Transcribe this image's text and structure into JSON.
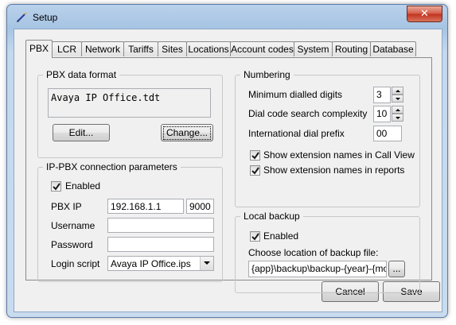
{
  "window": {
    "title": "Setup",
    "close_glyph": "✕",
    "icon": "pen-icon"
  },
  "tabs": [
    "PBX",
    "LCR",
    "Network",
    "Tariffs",
    "Sites",
    "Locations",
    "Account codes",
    "System",
    "Routing",
    "Database"
  ],
  "active_tab": "PBX",
  "pbx_data_format": {
    "legend": "PBX data format",
    "value": "Avaya IP Office.tdt",
    "edit_label": "Edit...",
    "change_label": "Change..."
  },
  "connection": {
    "legend": "IP-PBX connection parameters",
    "enabled_label": "Enabled",
    "enabled_checked": true,
    "pbx_ip_label": "PBX IP",
    "pbx_ip_value": "192.168.1.1",
    "port_value": "9000",
    "username_label": "Username",
    "username_value": "",
    "password_label": "Password",
    "password_value": "",
    "login_script_label": "Login script",
    "login_script_value": "Avaya IP Office.ips"
  },
  "numbering": {
    "legend": "Numbering",
    "min_digits_label": "Minimum dialled digits",
    "min_digits_value": "3",
    "complexity_label": "Dial code search complexity",
    "complexity_value": "10",
    "intl_prefix_label": "International dial prefix",
    "intl_prefix_value": "00",
    "show_callview_label": "Show extension names in Call View",
    "show_callview_checked": true,
    "show_reports_label": "Show extension names in reports",
    "show_reports_checked": true
  },
  "backup": {
    "legend": "Local backup",
    "enabled_label": "Enabled",
    "enabled_checked": true,
    "location_label": "Choose location of backup file:",
    "location_value": "{app}\\backup\\backup-{year}-{mor",
    "browse_label": "..."
  },
  "footer": {
    "cancel_label": "Cancel",
    "save_label": "Save"
  }
}
